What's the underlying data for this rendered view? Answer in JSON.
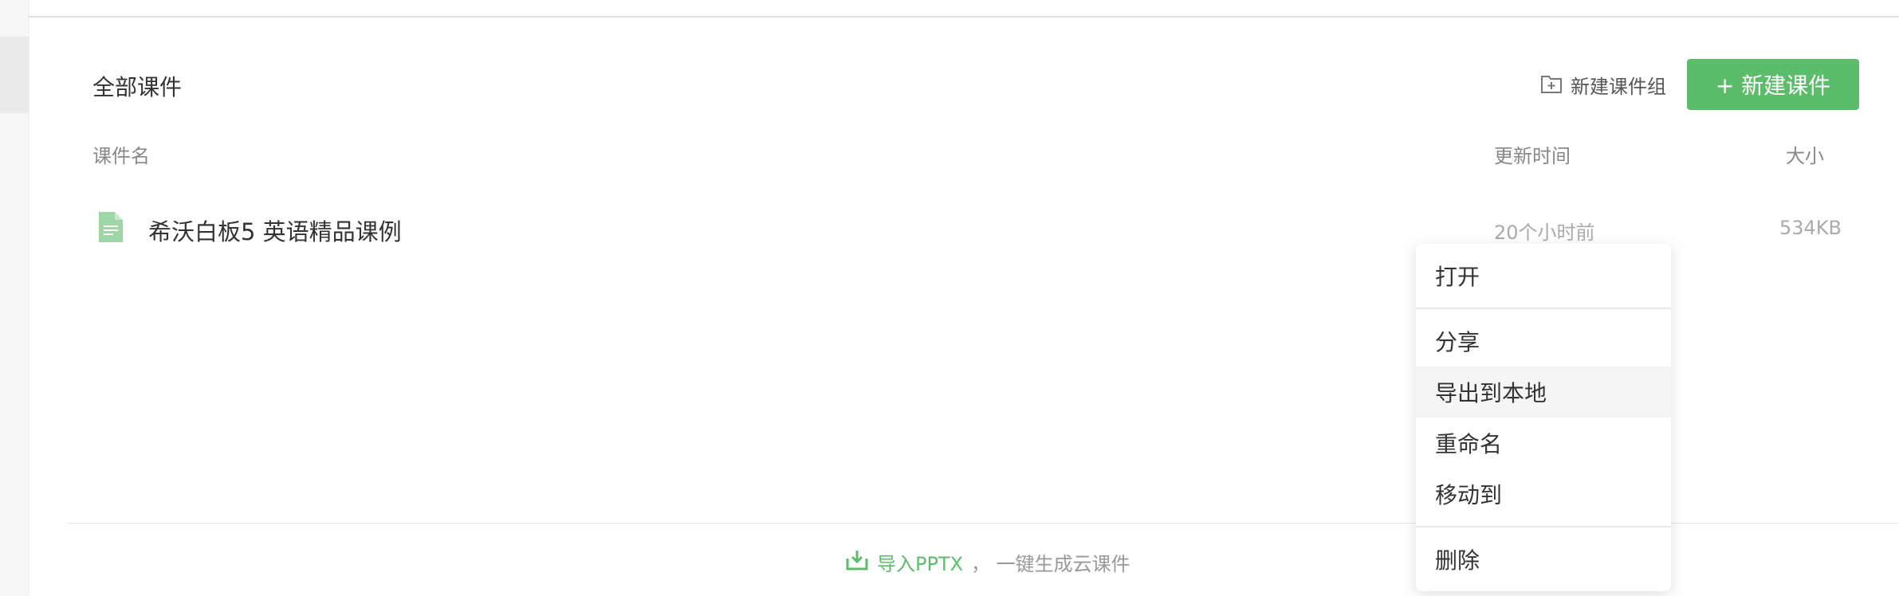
{
  "header": {
    "section_title": "全部课件",
    "new_group_label": "新建课件组",
    "new_course_label": "+ 新建课件"
  },
  "table": {
    "columns": [
      "课件名",
      "更新时间",
      "大小"
    ],
    "rows": [
      {
        "name": "希沃白板5 英语精品课例",
        "updated": "20个小时前",
        "size": "534KB"
      }
    ]
  },
  "footer": {
    "import_link": "导入PPTX",
    "import_desc": "， 一键生成云课件"
  },
  "context_menu": {
    "items": [
      "打开",
      "分享",
      "导出到本地",
      "重命名",
      "移动到",
      "删除"
    ],
    "hovered": "导出到本地"
  },
  "colors": {
    "accent": "#5bbd6b",
    "file_icon": "#9fd6a8"
  },
  "icons": {
    "new_group": "folder-plus-icon",
    "file": "document-icon",
    "import": "import-icon"
  }
}
